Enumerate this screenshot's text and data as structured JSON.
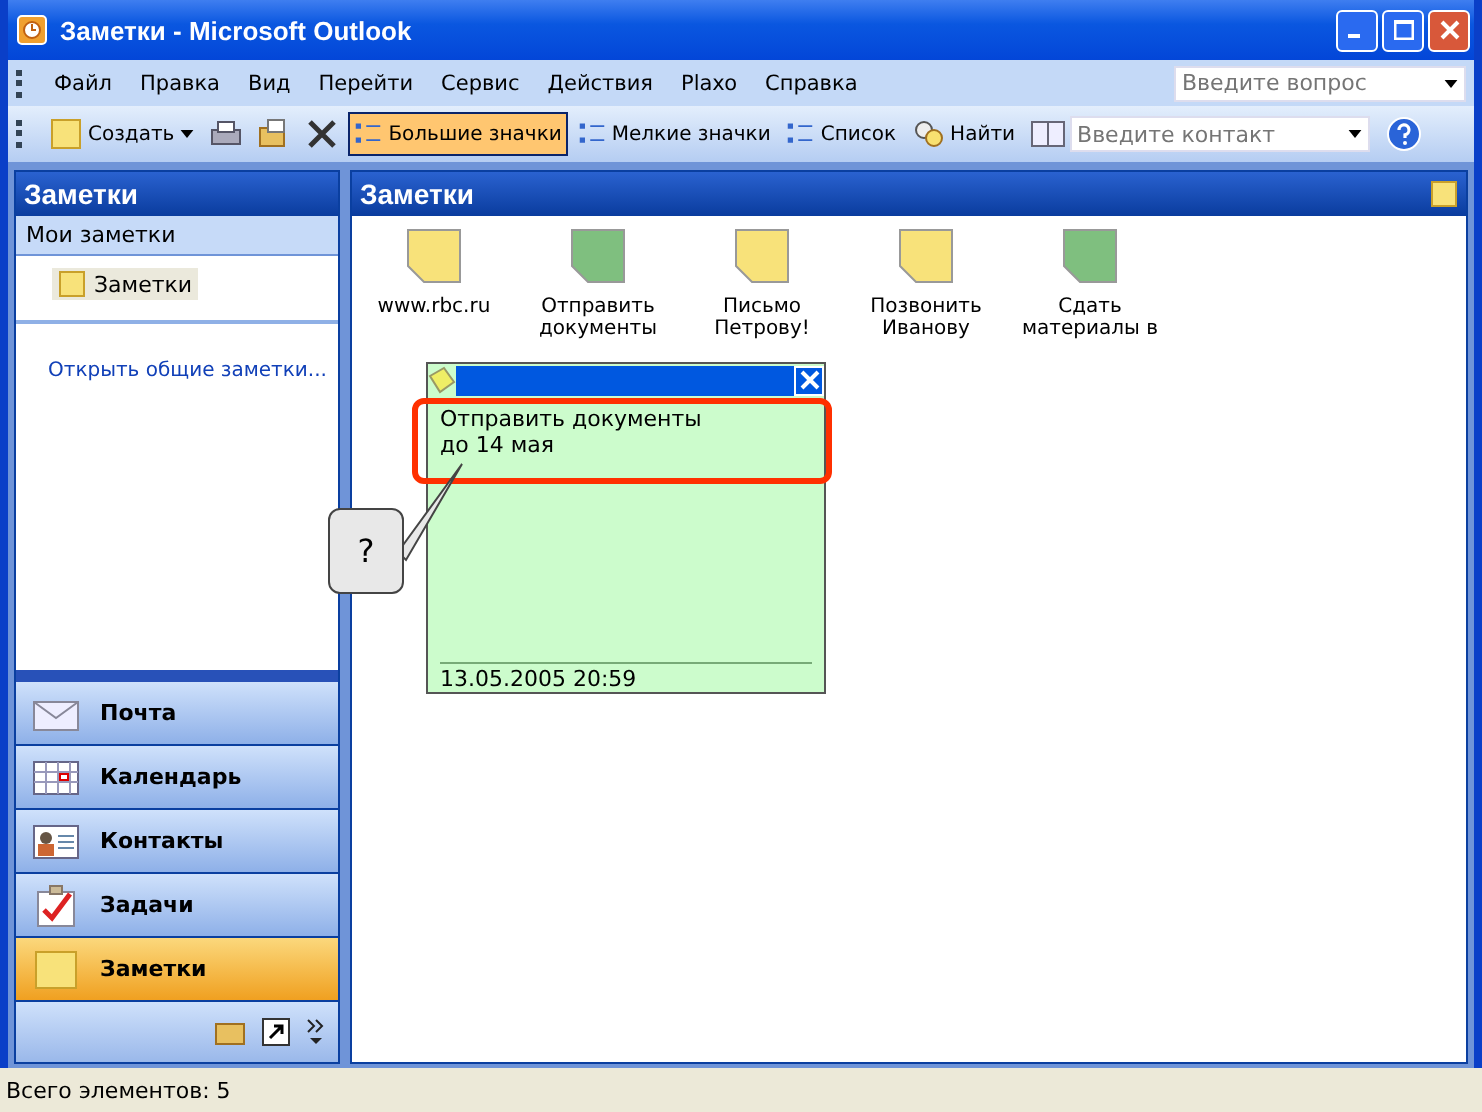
{
  "window": {
    "title": "Заметки - Microsoft Outlook"
  },
  "menu": [
    "Файл",
    "Правка",
    "Вид",
    "Перейти",
    "Сервис",
    "Действия",
    "Plaxo",
    "Справка"
  ],
  "question": {
    "placeholder": "Введите вопрос"
  },
  "toolbar": [
    {
      "kind": "new",
      "label": "Создать",
      "selected": false
    },
    {
      "kind": "print",
      "selected": false
    },
    {
      "kind": "move",
      "selected": false
    },
    {
      "kind": "delete",
      "selected": false
    },
    {
      "kind": "large",
      "label": "Большие значки",
      "selected": true
    },
    {
      "kind": "small",
      "label": "Мелкие значки",
      "selected": false
    },
    {
      "kind": "list",
      "label": "Список",
      "selected": false
    },
    {
      "kind": "find",
      "label": "Найти",
      "selected": false
    }
  ],
  "contact": {
    "placeholder": "Введите контакт"
  },
  "sidebar": {
    "title": "Заметки",
    "section": "Мои заметки",
    "folder": "Заметки",
    "link": "Открыть общие заметки..."
  },
  "nav": [
    {
      "kind": "mail",
      "label": "Почта",
      "selected": false
    },
    {
      "kind": "calendar",
      "label": "Календарь",
      "selected": false
    },
    {
      "kind": "contacts",
      "label": "Контакты",
      "selected": false
    },
    {
      "kind": "tasks",
      "label": "Задачи",
      "selected": false
    },
    {
      "kind": "notes",
      "label": "Заметки",
      "selected": true
    }
  ],
  "main": {
    "title": "Заметки"
  },
  "notes": [
    {
      "label": "www.rbc.ru",
      "color": "#f8e27a"
    },
    {
      "label": "Отправить документы",
      "color": "#7fbf7f"
    },
    {
      "label": "Письмо Петрову!",
      "color": "#f8e27a"
    },
    {
      "label": "Позвонить Иванову",
      "color": "#f8e27a"
    },
    {
      "label": "Сдать материалы в",
      "color": "#7fbf7f"
    }
  ],
  "open_note": {
    "text": "Отправить документы\nдо 14 мая",
    "date": "13.05.2005 20:59"
  },
  "callout": "?",
  "status_bar": "Всего элементов: 5"
}
